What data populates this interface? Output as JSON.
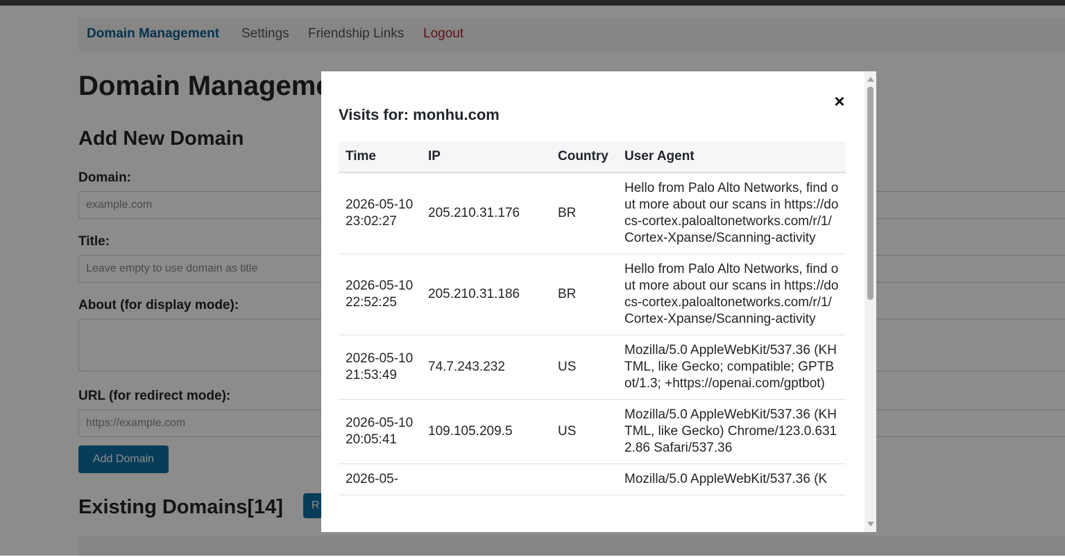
{
  "nav": {
    "domain_management": "Domain Management",
    "settings": "Settings",
    "friendship_links": "Friendship Links",
    "logout": "Logout"
  },
  "page": {
    "title": "Domain Management",
    "add_section": "Add New Domain",
    "domain_label": "Domain:",
    "domain_placeholder": "example.com",
    "title_label": "Title:",
    "title_placeholder": "Leave empty to use domain as title",
    "about_label": "About (for display mode):",
    "url_label": "URL (for redirect mode):",
    "url_placeholder": "https://example.com",
    "add_button": "Add Domain",
    "existing_section": "Existing Domains[14]",
    "refresh_button": "R"
  },
  "modal": {
    "title": "Visits for: monhu.com",
    "close": "×",
    "columns": [
      "Time",
      "IP",
      "Country",
      "User Agent"
    ],
    "rows": [
      {
        "time": "2026-05-10 23:02:27",
        "ip": "205.210.31.176",
        "country": "BR",
        "ua": "Hello from Palo Alto Networks, find out more about our scans in https://docs-cortex.paloaltonetworks.com/r/1/Cortex-Xpanse/Scanning-activity"
      },
      {
        "time": "2026-05-10 22:52:25",
        "ip": "205.210.31.186",
        "country": "BR",
        "ua": "Hello from Palo Alto Networks, find out more about our scans in https://docs-cortex.paloaltonetworks.com/r/1/Cortex-Xpanse/Scanning-activity"
      },
      {
        "time": "2026-05-10 21:53:49",
        "ip": "74.7.243.232",
        "country": "US",
        "ua": "Mozilla/5.0 AppleWebKit/537.36 (KHTML, like Gecko; compatible; GPTBot/1.3; +https://openai.com/gptbot)"
      },
      {
        "time": "2026-05-10 20:05:41",
        "ip": "109.105.209.5",
        "country": "US",
        "ua": "Mozilla/5.0 AppleWebKit/537.36 (KHTML, like Gecko) Chrome/123.0.6312.86 Safari/537.36"
      },
      {
        "time": "2026-05-",
        "ip": "",
        "country": "",
        "ua": "Mozilla/5.0 AppleWebKit/537.36 (K"
      }
    ]
  },
  "colors": {
    "accent": "#0d6fa0",
    "logout": "#b0202a"
  }
}
